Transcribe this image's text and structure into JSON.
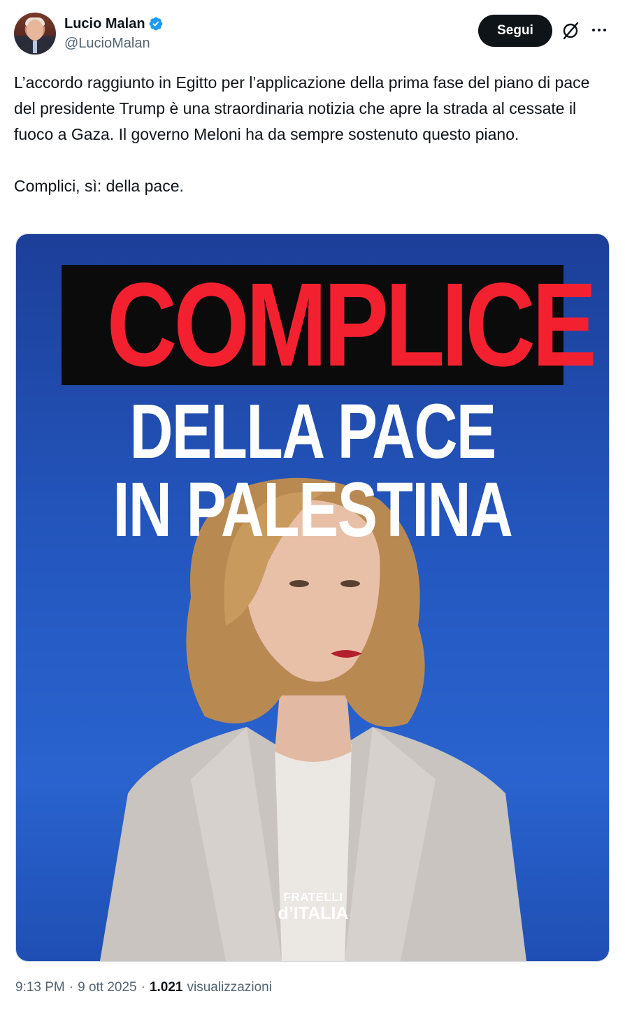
{
  "author": {
    "display_name": "Lucio Malan",
    "handle": "@LucioMalan",
    "verified": true,
    "verified_color": "#1d9bf0"
  },
  "actions": {
    "follow_label": "Segui",
    "grok_icon": "grok-icon",
    "more_icon": "more-icon"
  },
  "tweet": {
    "text": "L’accordo raggiunto in Egitto per l’applicazione della prima fase del piano di pace del presidente Trump è una straordinaria notizia che apre la strada al cessate il fuoco a Gaza. Il governo Meloni ha da sempre sostenuto questo piano.\n\nComplici, sì: della pace."
  },
  "media": {
    "headline_red": "COMPLICE",
    "headline_white_1": "DELLA PACE",
    "headline_white_2": "IN PALESTINA",
    "logo_top": "FRATELLI",
    "logo_bottom": "d’ITALIA",
    "background_color": "#2458c0",
    "headline_red_color": "#f3212f"
  },
  "meta": {
    "time": "9:13 PM",
    "separator": "·",
    "date": "9 ott 2025",
    "views_count": "1.021",
    "views_label": "visualizzazioni"
  }
}
